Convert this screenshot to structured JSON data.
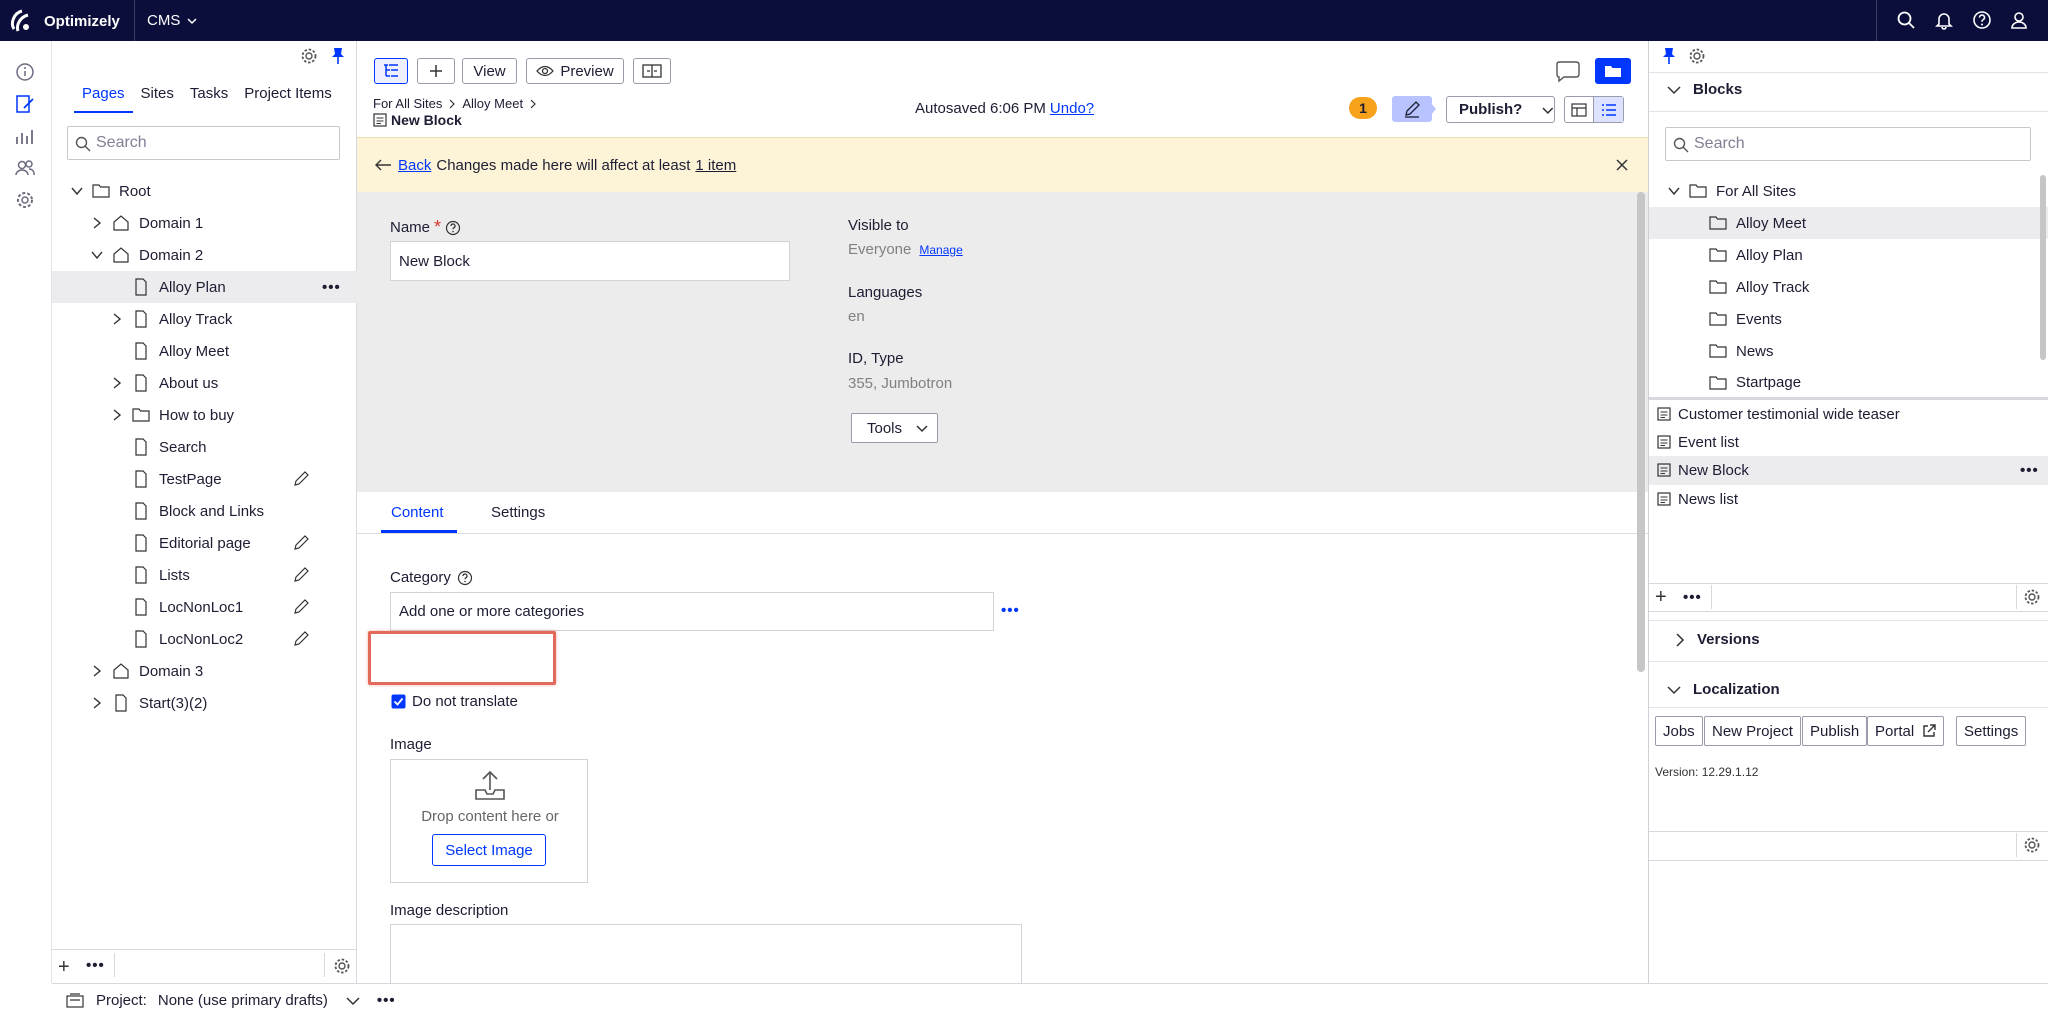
{
  "topbar": {
    "brand": "Optimizely",
    "product": "CMS"
  },
  "tree": {
    "tabs": [
      "Pages",
      "Sites",
      "Tasks",
      "Project Items"
    ],
    "search_placeholder": "Search",
    "items": [
      {
        "label": "Root"
      },
      {
        "label": "Domain 1"
      },
      {
        "label": "Domain 2"
      },
      {
        "label": "Alloy Plan"
      },
      {
        "label": "Alloy Track"
      },
      {
        "label": "Alloy Meet"
      },
      {
        "label": "About us"
      },
      {
        "label": "How to buy"
      },
      {
        "label": "Search"
      },
      {
        "label": "TestPage"
      },
      {
        "label": "Block and Links"
      },
      {
        "label": "Editorial page"
      },
      {
        "label": "Lists"
      },
      {
        "label": "LocNonLoc1"
      },
      {
        "label": "LocNonLoc2"
      },
      {
        "label": "Domain 3"
      },
      {
        "label": "Start(3)(2)"
      }
    ]
  },
  "toolbar": {
    "view": "View",
    "preview": "Preview",
    "publish": "Publish?",
    "badge": "1"
  },
  "breadcrumb": {
    "root": "For All Sites",
    "parent": "Alloy Meet",
    "title": "New Block"
  },
  "autosave": {
    "text": "Autosaved 6:06 PM",
    "undo": "Undo?"
  },
  "notice": {
    "back": "Back",
    "text": "Changes made here will affect at least",
    "link": "1 item"
  },
  "form": {
    "name_label": "Name",
    "required": "*",
    "name_value": "New Block",
    "visible_label": "Visible to",
    "visible_value": "Everyone",
    "manage": "Manage",
    "languages_label": "Languages",
    "languages_value": "en",
    "id_label": "ID, Type",
    "id_value": "355, Jumbotron",
    "tools": "Tools"
  },
  "content_tabs": [
    "Content",
    "Settings"
  ],
  "content": {
    "category_label": "Category",
    "category_placeholder": "Add one or more categories",
    "do_not_translate": "Do not translate",
    "image_label": "Image",
    "drop_text": "Drop content here or",
    "select_image": "Select Image",
    "image_desc_label": "Image description"
  },
  "right": {
    "blocks_title": "Blocks",
    "search_placeholder": "Search",
    "folders": [
      "For All Sites",
      "Alloy Meet",
      "Alloy Plan",
      "Alloy Track",
      "Events",
      "News",
      "Startpage"
    ],
    "blocks": [
      "Customer testimonial wide teaser",
      "Event list",
      "New Block",
      "News list"
    ],
    "versions": "Versions",
    "localization": "Localization",
    "loc_buttons": [
      "Jobs",
      "New Project",
      "Publish",
      "Portal",
      "Settings"
    ],
    "version_text": "Version: 12.29.1.12"
  },
  "bottom": {
    "project_label": "Project:",
    "project_value": "None (use primary drafts)"
  },
  "colors": {
    "topbar": "#0b0e3a",
    "accent": "#0037ff",
    "notice": "#fdf4d8",
    "badge": "#f7a21b",
    "highlight": "#e26a5a"
  }
}
